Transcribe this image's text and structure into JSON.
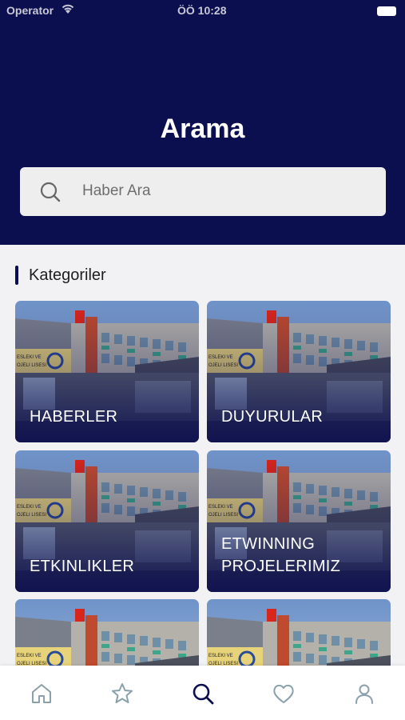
{
  "status_bar": {
    "carrier": "Operator",
    "time": "ÖÖ 10:28"
  },
  "header": {
    "title": "Arama"
  },
  "search": {
    "placeholder": "Haber Ara",
    "value": ""
  },
  "section": {
    "title": "Kategoriler"
  },
  "categories": [
    {
      "label": "HABERLER"
    },
    {
      "label": "DUYURULAR"
    },
    {
      "label": "ETKINLIKLER"
    },
    {
      "label": "ETWINNING\nPROJELERIMIZ"
    },
    {
      "label": ""
    },
    {
      "label": ""
    }
  ],
  "tabbar": {
    "tabs": [
      {
        "icon": "home-icon",
        "active": false
      },
      {
        "icon": "star-icon",
        "active": false
      },
      {
        "icon": "search-icon",
        "active": true
      },
      {
        "icon": "heart-icon",
        "active": false
      },
      {
        "icon": "user-icon",
        "active": false
      }
    ]
  },
  "colors": {
    "header_bg": "#0b0e4f",
    "active_tab": "#0b0e4f",
    "inactive_tab": "#8aa0ab"
  }
}
